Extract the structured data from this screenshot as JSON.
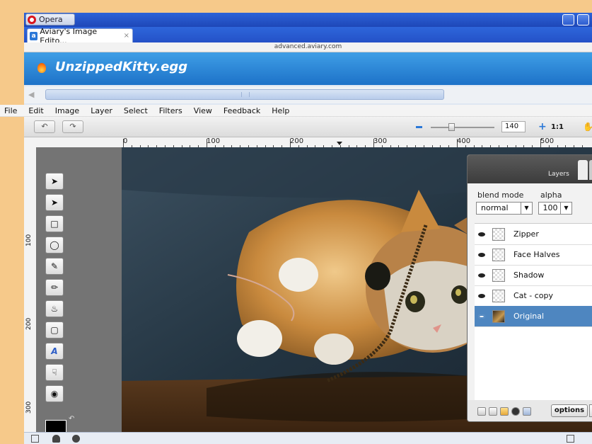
{
  "browser": {
    "app_name": "Opera",
    "tab_title": "Aviary's Image Edito...",
    "tab_close": "×",
    "url": "advanced.aviary.com"
  },
  "editor": {
    "document_title": "UnzippedKitty.egg",
    "menu": [
      "File",
      "Edit",
      "Image",
      "Layer",
      "Select",
      "Filters",
      "View",
      "Feedback",
      "Help"
    ],
    "zoom_value": "140",
    "zoom_reset": "1:1",
    "ruler_h_labels": [
      "0",
      "100",
      "200",
      "300",
      "400",
      "500"
    ],
    "ruler_v_labels": [
      "100",
      "200",
      "300"
    ]
  },
  "layers_panel": {
    "title": "Layers",
    "blend_mode_label": "blend mode",
    "alpha_label": "alpha",
    "blend_mode_value": "normal",
    "alpha_value": "100",
    "options_label": "options",
    "layers": [
      {
        "name": "Zipper",
        "selected": false
      },
      {
        "name": "Face Halves",
        "selected": false
      },
      {
        "name": "Shadow",
        "selected": false
      },
      {
        "name": "Cat - copy",
        "selected": false
      },
      {
        "name": "Original",
        "selected": true
      }
    ]
  },
  "colors": {
    "accent": "#2b78d8",
    "header_blue": "#1d72c8",
    "selected_layer": "#4e86c0",
    "foreground_color": "#000000",
    "background_color": "#ffffff"
  },
  "icons": {
    "tools": [
      "pointer-icon",
      "node-select-icon",
      "marquee-icon",
      "lasso-icon",
      "dropper-icon",
      "brush-icon",
      "fill-icon",
      "rectangle-icon",
      "text-icon",
      "smudge-icon",
      "stamp-icon"
    ]
  }
}
